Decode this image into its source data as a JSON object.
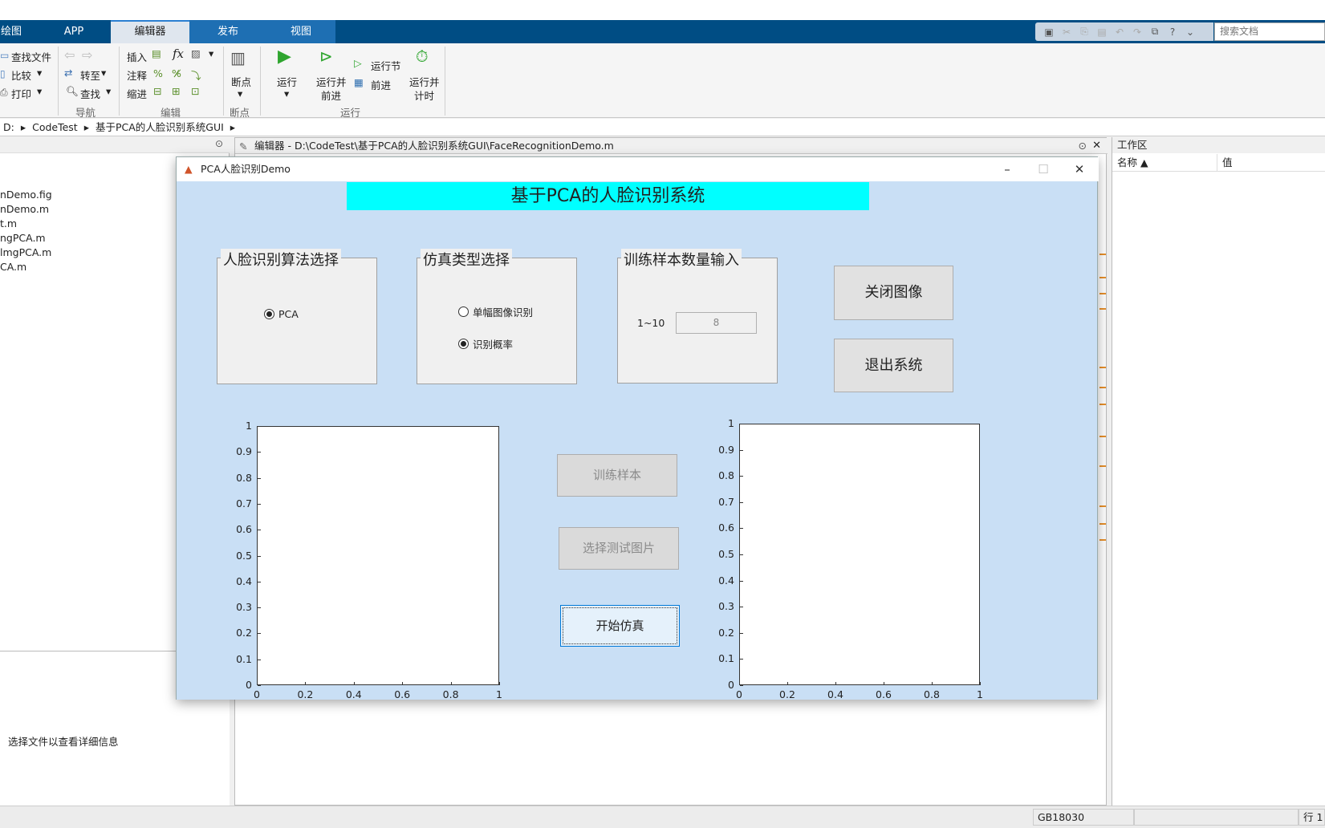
{
  "tabs": {
    "tab0": "绘图",
    "tab1": "APP",
    "tab2": "编辑器",
    "tab3": "发布",
    "tab4": "视图"
  },
  "search": {
    "placeholder": "搜索文档"
  },
  "ribbon": {
    "find_files": "查找文件",
    "compare": "比较",
    "print": "打印",
    "goto": "转至",
    "find": "查找",
    "nav_group": "导航",
    "insert": "插入",
    "comment": "注释",
    "indent": "缩进",
    "fx": "fx",
    "edit_group": "编辑",
    "breakpoint": "断点",
    "breakpoint_group": "断点",
    "run": "运行",
    "run_advance_1": "运行并",
    "run_advance_2": "前进",
    "run_section": "运行节",
    "advance": "前进",
    "run_time_1": "运行并",
    "run_time_2": "计时",
    "run_group": "运行"
  },
  "address": {
    "drive": "D:",
    "folder1": "CodeTest",
    "folder2": "基于PCA的人脸识别系统GUI"
  },
  "files": [
    "nDemo.fig",
    "nDemo.m",
    "t.m",
    "ngPCA.m",
    "lmgPCA.m",
    "CA.m"
  ],
  "details_hint": "选择文件以查看详细信息",
  "editor": {
    "title": "编辑器 - D:\\CodeTest\\基于PCA的人脸识别系统GUI\\FaceRecognitionDemo.m"
  },
  "workspace": {
    "title": "工作区",
    "col_name": "名称 ▲",
    "col_value": "值"
  },
  "status": {
    "encoding": "GB18030",
    "line": "行 1"
  },
  "dialog": {
    "title": "PCA人脸识别Demo",
    "banner": "基于PCA的人脸识别系统",
    "algo_panel": {
      "title": "人脸识别算法选择",
      "option": "PCA"
    },
    "sim_panel": {
      "title": "仿真类型选择",
      "option1": "单幅图像识别",
      "option2": "识别概率"
    },
    "train_panel": {
      "title": "训练样本数量输入",
      "range": "1~10",
      "value": "8"
    },
    "close_img": "关闭图像",
    "exit": "退出系统",
    "train_btn": "训练样本",
    "select_test": "选择测试图片",
    "start_sim": "开始仿真",
    "axis_ticks": [
      "0",
      "0.1",
      "0.2",
      "0.3",
      "0.4",
      "0.5",
      "0.6",
      "0.7",
      "0.8",
      "0.9",
      "1"
    ],
    "x_ticks": [
      "0",
      "0.2",
      "0.4",
      "0.6",
      "0.8",
      "1"
    ]
  },
  "colors": {
    "tabbar": "#004d84",
    "dialog_bg": "#c9dff5",
    "banner": "#00ffff"
  }
}
